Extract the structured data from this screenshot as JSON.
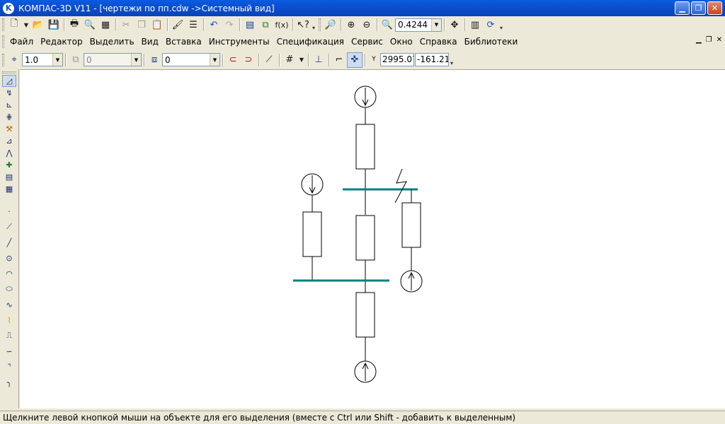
{
  "window": {
    "app_icon": "K",
    "title": "КОМПАС-3D V11 - [чертежи по пп.cdw ->Системный вид]",
    "controls": [
      "minimize-icon",
      "restore-icon",
      "close-icon"
    ]
  },
  "standard_toolbar": {
    "zoom_value": "0.4244",
    "icons": [
      "new-document-icon",
      "open-icon",
      "save-icon",
      "print-icon",
      "print-preview-icon",
      "page-setup-icon",
      "cut-icon",
      "copy-icon",
      "paste-icon",
      "format-painter-icon",
      "properties-icon",
      "undo-icon",
      "redo-icon",
      "manager-icon",
      "variables-icon",
      "function-icon",
      "help-icon",
      "zoom-window-icon",
      "zoom-in-icon",
      "zoom-out-icon",
      "zoom-scale-icon",
      "pan-icon",
      "refresh-icon",
      "regenerate-icon"
    ],
    "fx_label": "f(x)"
  },
  "menu": {
    "items": [
      "Файл",
      "Редактор",
      "Выделить",
      "Вид",
      "Вставка",
      "Инструменты",
      "Спецификация",
      "Сервис",
      "Окно",
      "Справка",
      "Библиотеки"
    ],
    "mdi_controls": [
      "mdi-minimize-icon",
      "mdi-restore-icon",
      "mdi-close-icon"
    ]
  },
  "current_state": {
    "step_value": "1.0",
    "view_value": "0",
    "layer_value": "0",
    "y_label": "Y",
    "x_coord": "2995.07",
    "y_coord": "-161.21",
    "icons": [
      "local-cs-icon",
      "view-state-icon",
      "layer-icon",
      "snap-icon",
      "snap-settings-icon",
      "orthogonal-icon",
      "grid-icon",
      "local-axis-icon",
      "round-icon",
      "magnet-active-icon",
      "coordinates-icon"
    ]
  },
  "compact_panel": {
    "groups": [
      "geometry-icon",
      "dimensions-icon",
      "designations-icon",
      "parametrization-icon",
      "edit-icon",
      "measure-icon",
      "select-icon",
      "spec-icon",
      "reports-icon",
      "fragment-icon"
    ],
    "tools": [
      "point-icon",
      "auxiliary-line-icon",
      "segment-icon",
      "circle-icon",
      "arc-icon",
      "ellipse-icon",
      "spline-icon",
      "polyline-icon",
      "continuous-object-icon",
      "bezier-icon",
      "chamfer-icon",
      "rounding-icon"
    ]
  },
  "drawing": {
    "line_color": "#000000",
    "bus_color": "#008080"
  },
  "status": {
    "text": "Щелкните левой кнопкой мыши на объекте для его выделения (вместе с Ctrl или Shift - добавить к выделенным)"
  }
}
